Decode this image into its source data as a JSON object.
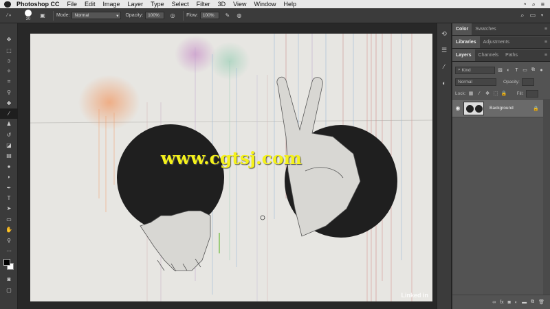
{
  "menubar": {
    "app": "Photoshop CC",
    "items": [
      "File",
      "Edit",
      "Image",
      "Layer",
      "Type",
      "Select",
      "Filter",
      "3D",
      "View",
      "Window",
      "Help"
    ]
  },
  "options": {
    "brush_size": "30",
    "mode_label": "Mode:",
    "mode_value": "Normal",
    "opacity_label": "Opacity:",
    "opacity_value": "100%",
    "flow_label": "Flow:",
    "flow_value": "100%"
  },
  "canvas": {
    "watermark": "www.cgtsj.com",
    "badge": "Linked in"
  },
  "panels": {
    "top_tabs": [
      "Color",
      "Swatches"
    ],
    "mid_tabs": [
      "Libraries",
      "Adjustments"
    ],
    "layer_tabs": [
      "Layers",
      "Channels",
      "Paths"
    ],
    "filter_placeholder": "Kind",
    "blend_mode": "Normal",
    "opacity_label": "Opacity:",
    "lock_label": "Lock:",
    "fill_label": "Fill:",
    "layer_name": "Background"
  },
  "colors": {
    "accent_yellow": "#f5f21a",
    "foreground": "#000000",
    "background": "#ffffff"
  }
}
